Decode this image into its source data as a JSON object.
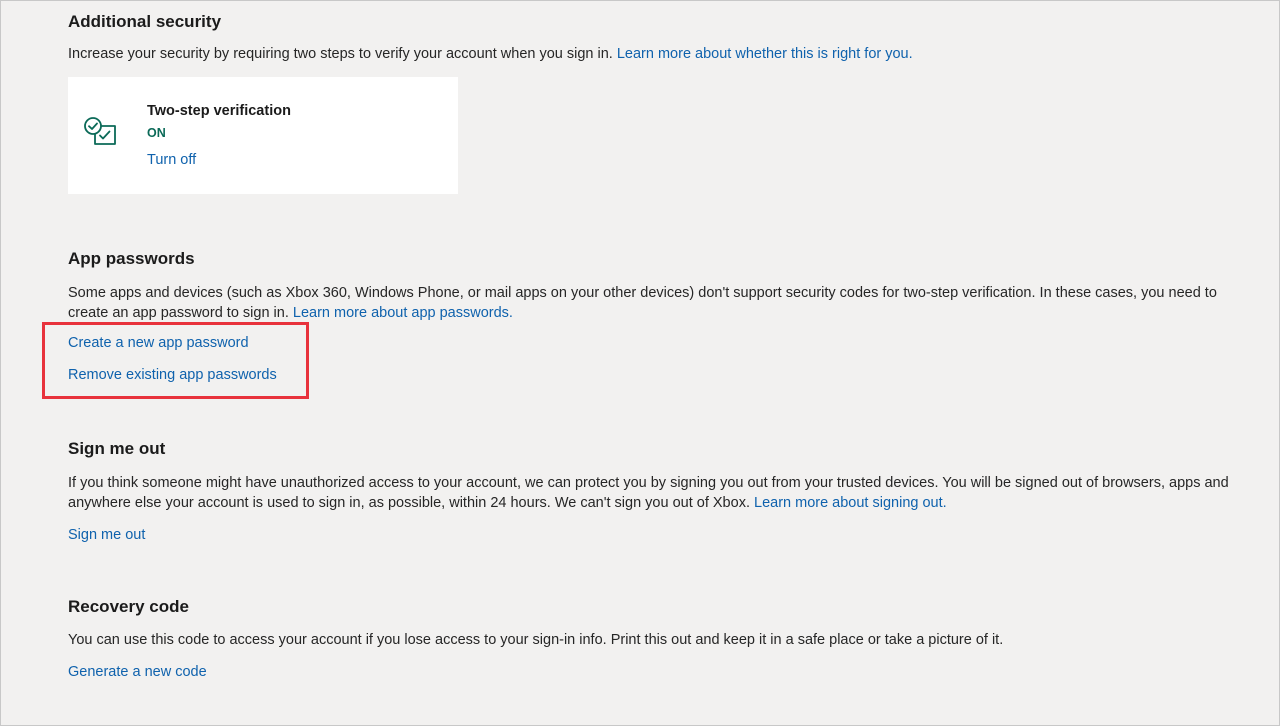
{
  "additional_security": {
    "title": "Additional security",
    "description": "Increase your security by requiring two steps to verify your account when you sign in.",
    "learn_more": "Learn more about whether this is right for you.",
    "two_step": {
      "title": "Two-step verification",
      "status": "ON",
      "action": "Turn off",
      "icon": "shield-check-icon"
    }
  },
  "app_passwords": {
    "title": "App passwords",
    "description": "Some apps and devices (such as Xbox 360, Windows Phone, or mail apps on your other devices) don't support security codes for two-step verification. In these cases, you need to create an app password to sign in.",
    "learn_more": "Learn more about app passwords.",
    "create_link": "Create a new app password",
    "remove_link": "Remove existing app passwords",
    "highlight_color": "#e8323c"
  },
  "sign_me_out": {
    "title": "Sign me out",
    "description": "If you think someone might have unauthorized access to your account, we can protect you by signing you out from your trusted devices. You will be signed out of browsers, apps and anywhere else your account is used to sign in, as possible, within 24 hours. We can't sign you out of Xbox.",
    "learn_more": "Learn more about signing out.",
    "action": "Sign me out"
  },
  "recovery_code": {
    "title": "Recovery code",
    "description": "You can use this code to access your account if you lose access to your sign-in info. Print this out and keep it in a safe place or take a picture of it.",
    "action": "Generate a new code"
  },
  "colors": {
    "link": "#0f62ad",
    "status_on": "#0b6a58",
    "background": "#f2f1f0"
  }
}
